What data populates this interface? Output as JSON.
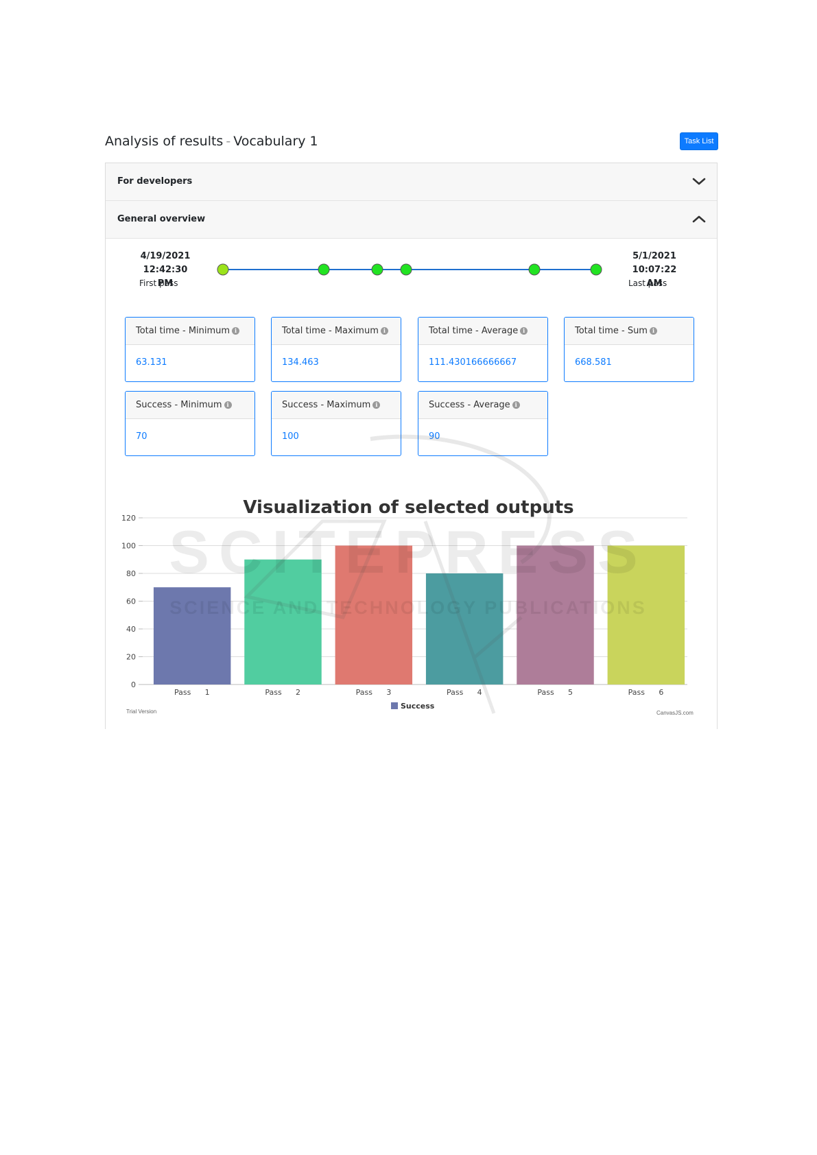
{
  "header": {
    "title": "Analysis of results",
    "separator": "-",
    "subtitle": "Vocabulary 1",
    "task_list_button": "Task List"
  },
  "accordion": {
    "developers": {
      "label": "For developers",
      "state": "collapsed",
      "icon": "chevron-down-icon"
    },
    "overview": {
      "label": "General overview",
      "state": "expanded",
      "icon": "chevron-up-icon"
    }
  },
  "timeline": {
    "first_date": "4/19/2021",
    "first_time": "12:42:30 PM",
    "first_label": "First pass",
    "last_date": "5/1/2021 10:07:22",
    "last_time": "AM",
    "last_label": "Last pass",
    "point_color_first": "#9be31b",
    "point_color": "#22e322",
    "line_color": "#1f6fcf"
  },
  "stats": {
    "tt_min": {
      "label": "Total time - Minimum",
      "value": "63.131"
    },
    "tt_max": {
      "label": "Total time - Maximum",
      "value": "134.463"
    },
    "tt_avg": {
      "label": "Total time - Average",
      "value": "111.430166666667"
    },
    "tt_sum": {
      "label": "Total time - Sum",
      "value": "668.581"
    },
    "s_min": {
      "label": "Success - Minimum",
      "value": "70"
    },
    "s_max": {
      "label": "Success - Maximum",
      "value": "100"
    },
    "s_avg": {
      "label": "Success - Average",
      "value": "90"
    }
  },
  "chart_footer": {
    "trial": "Trial Version",
    "credit": "CanvasJS.com"
  },
  "watermark": {
    "line1": "SCITEPRESS",
    "line2": "SCIENCE AND TECHNOLOGY PUBLICATIONS"
  },
  "chart_data": {
    "type": "bar",
    "title": "Visualization of selected outputs",
    "categories": [
      "Pass 1",
      "Pass 2",
      "Pass 3",
      "Pass 4",
      "Pass 5",
      "Pass 6"
    ],
    "category_labels": [
      [
        "Pass",
        "1"
      ],
      [
        "Pass",
        "2"
      ],
      [
        "Pass",
        "3"
      ],
      [
        "Pass",
        "4"
      ],
      [
        "Pass",
        "5"
      ],
      [
        "Pass",
        "6"
      ]
    ],
    "series": [
      {
        "name": "Success",
        "values": [
          70,
          90,
          100,
          80,
          100,
          100
        ]
      }
    ],
    "bar_colors": [
      "#6d78ad",
      "#51cda0",
      "#df7970",
      "#4c9ca0",
      "#ae7d99",
      "#c9d45c"
    ],
    "legend_color": "#6d78ad",
    "ylim": [
      0,
      120
    ],
    "yticks": [
      0,
      20,
      40,
      60,
      80,
      100,
      120
    ],
    "grid": true,
    "legend": "bottom-center"
  }
}
